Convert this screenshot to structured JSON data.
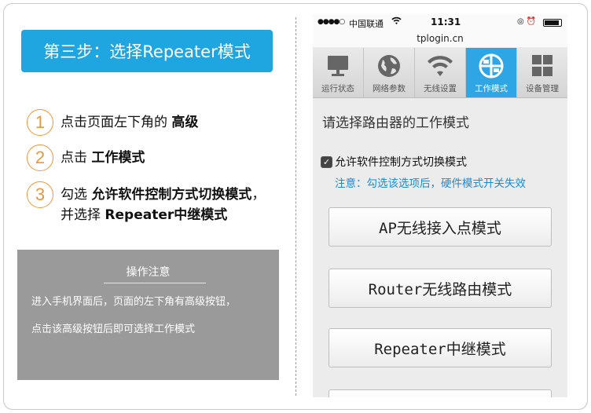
{
  "left": {
    "step_title": "第三步：选择Repeater模式",
    "steps": [
      {
        "num": "1",
        "pre": "点击页面左下角的 ",
        "bold": "高级",
        "post": ""
      },
      {
        "num": "2",
        "pre": "点击 ",
        "bold": "工作模式",
        "post": ""
      },
      {
        "num": "3",
        "pre": "勾选 ",
        "bold": "允许软件控制方式切换模式",
        "post": "，并选择 ",
        "bold2": "Repeater中继模式"
      }
    ],
    "note": {
      "title": "操作注意",
      "line1": "进入手机界面后，页面的左下角有高级按钮，",
      "line2": "点击该高级按钮后即可选择工作模式"
    }
  },
  "phone": {
    "status": {
      "signal": "●●●●○",
      "carrier": "中国联通",
      "wifi": "wifi-icon",
      "time": "11:31",
      "right_icons": "◎ ⏰",
      "battery": "battery-icon"
    },
    "url": "tplogin.cn",
    "nav": [
      {
        "label": "运行状态",
        "icon": "monitor-icon"
      },
      {
        "label": "网络参数",
        "icon": "globe-icon"
      },
      {
        "label": "无线设置",
        "icon": "wifi-icon"
      },
      {
        "label": "工作模式",
        "icon": "mode-icon"
      },
      {
        "label": "设备管理",
        "icon": "grid-icon"
      }
    ],
    "heading": "请选择路由器的工作模式",
    "checkbox_label": "允许软件控制方式切换模式",
    "checkbox_mark": "✓",
    "notice": "注意：勾选该选项后，硬件模式开关失效",
    "modes": [
      "AP无线接入点模式",
      "Router无线路由模式",
      "Repeater中继模式"
    ],
    "colors": {
      "accent": "#1fa6e0",
      "nav_active": "#2ea6e6",
      "step_orange": "#e8973a",
      "notice_blue": "#1a8ad8"
    }
  }
}
